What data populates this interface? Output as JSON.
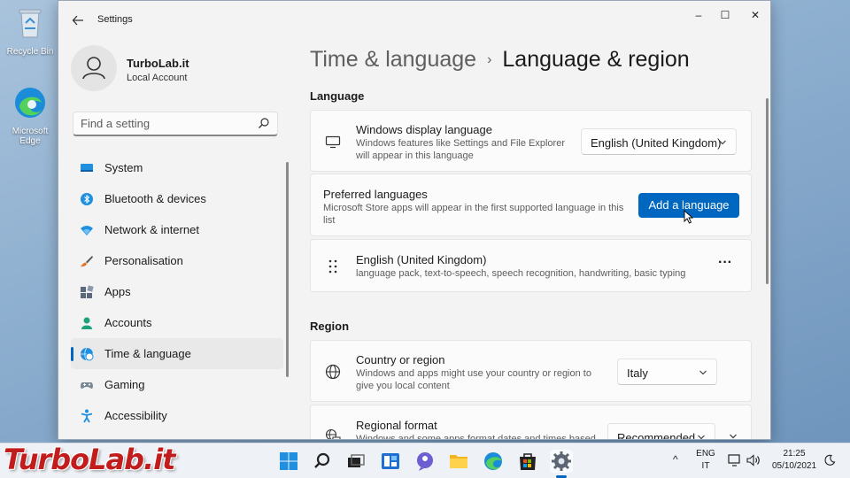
{
  "desktop": {
    "icons": [
      {
        "label": "Recycle Bin"
      },
      {
        "label": "Microsoft Edge"
      }
    ]
  },
  "window": {
    "title": "Settings",
    "controls": {
      "minimize": "–",
      "maximize": "☐",
      "close": "✕"
    }
  },
  "account": {
    "name": "TurboLab.it",
    "type": "Local Account"
  },
  "search": {
    "placeholder": "Find a setting"
  },
  "nav": {
    "items": [
      {
        "label": "System"
      },
      {
        "label": "Bluetooth & devices"
      },
      {
        "label": "Network & internet"
      },
      {
        "label": "Personalisation"
      },
      {
        "label": "Apps"
      },
      {
        "label": "Accounts"
      },
      {
        "label": "Time & language",
        "active": true
      },
      {
        "label": "Gaming"
      },
      {
        "label": "Accessibility"
      }
    ]
  },
  "breadcrumb": {
    "parent": "Time & language",
    "separator": "›",
    "current": "Language & region"
  },
  "language": {
    "section_title": "Language",
    "display_language": {
      "title": "Windows display language",
      "desc_line1": "Windows features like Settings and File Explorer",
      "desc_line2": "will appear in this language",
      "value": "English (United Kingdom)"
    },
    "preferred": {
      "title": "Preferred languages",
      "desc_line1": "Microsoft Store apps will appear in the first supported language in this",
      "desc_line2": "list",
      "button": "Add a language"
    },
    "installed": {
      "name": "English (United Kingdom)",
      "features": "language pack, text-to-speech, speech recognition, handwriting, basic typing",
      "more": "···"
    }
  },
  "region": {
    "section_title": "Region",
    "country": {
      "title": "Country or region",
      "desc_line1": "Windows and apps might use your country or region to",
      "desc_line2": "give you local content",
      "value": "Italy"
    },
    "format": {
      "title": "Regional format",
      "desc_line1": "Windows and some apps format dates and times based",
      "value": "Recommended"
    }
  },
  "taskbar": {
    "lang_top": "ENG",
    "lang_bottom": "IT",
    "time": "21:25",
    "date": "05/10/2021",
    "tray_chevron": "^"
  },
  "watermark": "TurboLab.it",
  "colors": {
    "accent": "#0067c0",
    "watermark": "#c21d1d"
  }
}
